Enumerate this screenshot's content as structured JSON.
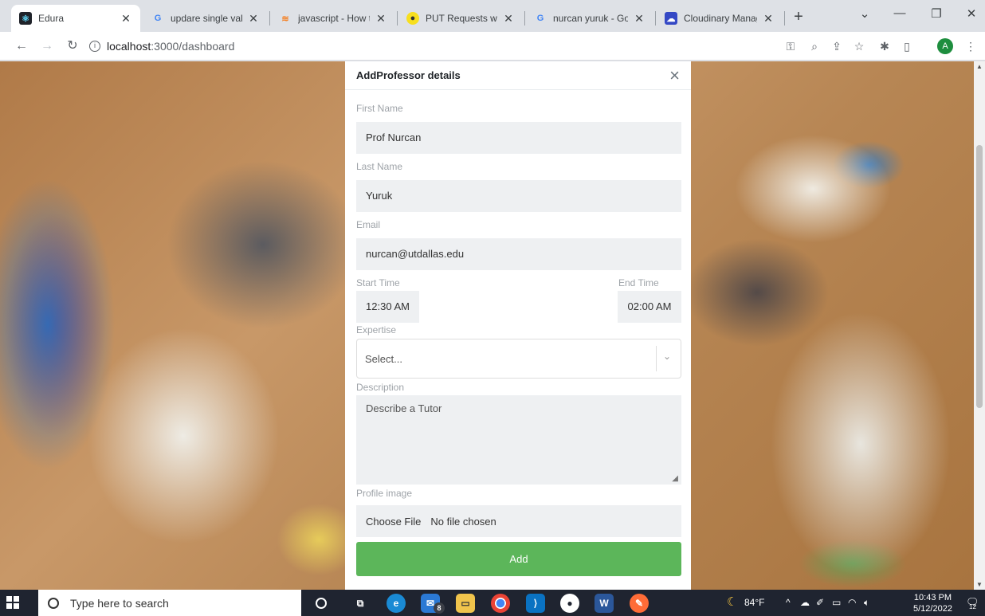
{
  "browser": {
    "tabs": [
      {
        "title": "Edura",
        "active": true
      },
      {
        "title": "updare single value",
        "active": false
      },
      {
        "title": "javascript - How to",
        "active": false
      },
      {
        "title": "PUT Requests with",
        "active": false
      },
      {
        "title": "nurcan yuruk - Goo",
        "active": false
      },
      {
        "title": "Cloudinary Manage",
        "active": false
      }
    ],
    "url_host": "localhost",
    "url_path": ":3000/dashboard"
  },
  "modal": {
    "title": "AddProfessor details",
    "first_name_label": "First Name",
    "first_name_value": "Prof Nurcan",
    "last_name_label": "Last Name",
    "last_name_value": "Yuruk",
    "email_label": "Email",
    "email_value": "nurcan@utdallas.edu",
    "start_time_label": "Start Time",
    "start_time_value": "12:30 AM",
    "end_time_label": "End Time",
    "end_time_value": "02:00 AM",
    "expertise_label": "Expertise",
    "expertise_placeholder": "Select...",
    "description_label": "Description",
    "description_placeholder": "Describe a Tutor",
    "profile_image_label": "Profile image",
    "choose_file_label": "Choose File",
    "no_file_label": "No file chosen",
    "add_button_label": "Add"
  },
  "taskbar": {
    "search_placeholder": "Type here to search",
    "mail_badge": "8",
    "temperature": "84°F",
    "time": "10:43 PM",
    "date": "5/12/2022",
    "notification_count": "12"
  },
  "colors": {
    "add_button": "#5cb65a",
    "input_background": "#eef0f2",
    "taskbar": "#1f2430"
  }
}
